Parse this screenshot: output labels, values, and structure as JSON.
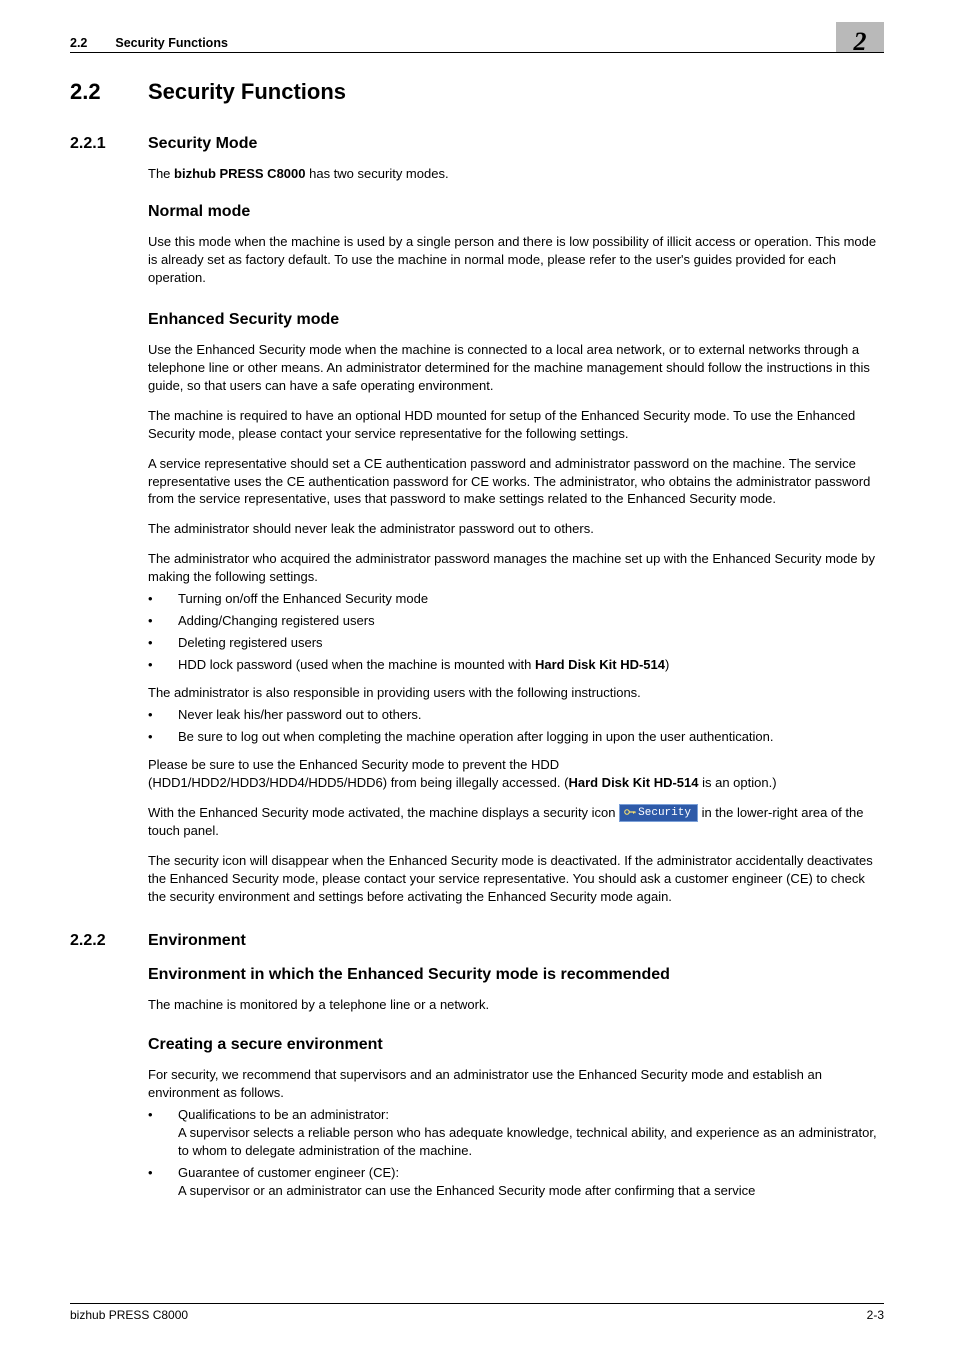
{
  "header": {
    "section_number": "2.2",
    "section_title": "Security Functions",
    "chapter_number": "2"
  },
  "h1": {
    "number": "2.2",
    "title": "Security Functions"
  },
  "sec_221": {
    "number": "2.2.1",
    "title": "Security Mode",
    "intro_pre": "The ",
    "intro_bold": "bizhub PRESS C8000",
    "intro_post": " has two security modes.",
    "normal_heading": "Normal mode",
    "normal_p1": "Use this mode when the machine is used by a single person and there is low possibility of illicit access or operation. This mode is already set as factory default. To use the machine in normal mode, please refer to the user's guides provided for each operation.",
    "enh_heading": "Enhanced Security mode",
    "enh_p1": "Use the Enhanced Security mode when the machine is connected to a local area network, or to external networks through a telephone line or other means. An administrator determined for the machine management should follow the instructions in this guide, so that users can have a safe operating environment.",
    "enh_p2": "The machine is required to have an optional HDD mounted for setup of the Enhanced Security mode. To use the Enhanced Security mode, please contact your service representative for the following settings.",
    "enh_p3": "A service representative should set a CE authentication password and administrator password on the machine. The service representative uses the CE authentication password for CE works. The administrator, who obtains the administrator password from the service representative, uses that password to make settings related to the Enhanced Security mode.",
    "enh_p4": "The administrator should never leak the administrator password out to others.",
    "enh_p5": "The administrator who acquired the administrator password manages the machine set up with the Enhanced Security mode by making the following settings.",
    "admin_bullets": [
      "Turning on/off the Enhanced Security mode",
      "Adding/Changing registered users",
      "Deleting registered users"
    ],
    "admin_bullet4_pre": "HDD lock password (used when the machine is mounted with ",
    "admin_bullet4_bold": "Hard Disk Kit HD-514",
    "admin_bullet4_post": ")",
    "enh_p6": "The administrator is also responsible in providing users with the following instructions.",
    "user_bullets": [
      "Never leak his/her password out to others.",
      "Be sure to log out when completing the machine operation after logging in upon the user authentication."
    ],
    "enh_p7_line1": "Please be sure to use the Enhanced Security mode to prevent the HDD",
    "enh_p7_line2_pre": "(HDD1/HDD2/HDD3/HDD4/HDD5/HDD6) from being illegally accessed. (",
    "enh_p7_line2_bold": "Hard Disk Kit HD-514",
    "enh_p7_line2_post": " is an option.)",
    "enh_p8_pre": "With the Enhanced Security mode activated, the machine displays a security icon  ",
    "security_icon_label": "Security",
    "enh_p8_post": "  in the lower-right area of the touch panel.",
    "enh_p9": "The security icon will disappear when the Enhanced Security mode is deactivated. If the administrator accidentally deactivates the Enhanced Security mode, please contact your service representative. You should ask a customer engineer (CE) to check the security environment and settings before activating the Enhanced Security mode again."
  },
  "sec_222": {
    "number": "2.2.2",
    "title": "Environment",
    "env_rec_heading": "Environment in which the Enhanced Security mode is recommended",
    "env_rec_p1": "The machine is monitored by a telephone line or a network.",
    "create_heading": "Creating a secure environment",
    "create_p1": "For security, we recommend that supervisors and an administrator use the Enhanced Security mode and establish an environment as follows.",
    "create_b1_head": "Qualifications to be an administrator:",
    "create_b1_body": "A supervisor selects a reliable person who has adequate knowledge, technical ability, and experience as an administrator, to whom to delegate administration of the machine.",
    "create_b2_head": "Guarantee of customer engineer (CE):",
    "create_b2_body": "A supervisor or an administrator can use the Enhanced Security mode after confirming that a service"
  },
  "footer": {
    "left": "bizhub PRESS C8000",
    "right": "2-3"
  }
}
